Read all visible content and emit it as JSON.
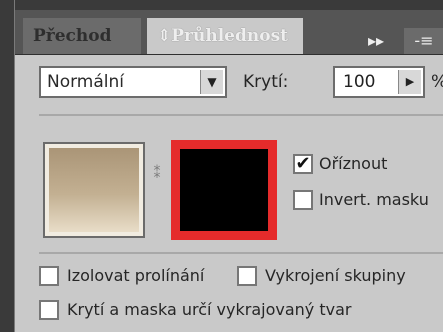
{
  "tabs": [
    {
      "label": "Přechod"
    },
    {
      "label": "Průhlednost",
      "prefix": "⇕"
    }
  ],
  "tabbar": {
    "collapse_glyph": "▸▸",
    "menu_glyph": "-≡"
  },
  "blend": {
    "mode": "Normální",
    "arrow": "▼"
  },
  "opacity": {
    "label": "Krytí:",
    "value": "100",
    "unit": "%",
    "arrow": "▶"
  },
  "link_glyph": "⁑",
  "checkboxes": {
    "clip": {
      "label": "Oříznout",
      "checked": true,
      "mark": "✔"
    },
    "invert": {
      "label": "Invert. masku",
      "checked": false
    },
    "isolate": {
      "label": "Izolovat prolínání",
      "checked": false
    },
    "knockout": {
      "label": "Vykrojení skupiny",
      "checked": false
    },
    "opacity_mask": {
      "label": "Krytí a maska určí vykrajovaný tvar",
      "checked": false
    }
  },
  "colors": {
    "mask_border": "#e52b2b",
    "mask_fill": "#000000",
    "panel_bg": "#c9c9c9"
  }
}
